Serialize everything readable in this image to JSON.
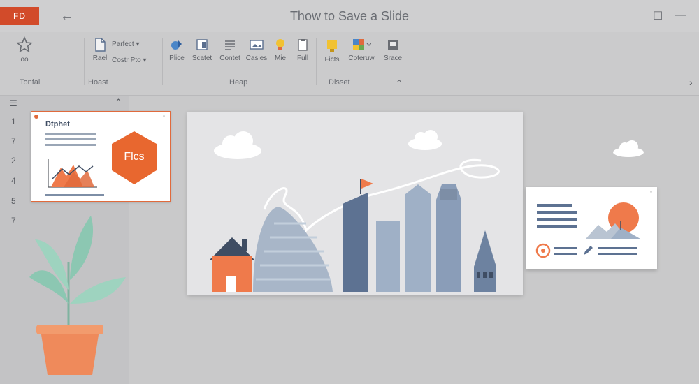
{
  "app": {
    "badge": "FD",
    "title": "Thow to Save a Slide"
  },
  "ribbon": {
    "favorite": {
      "label": "oo"
    },
    "home_items": [
      {
        "label": "Rael"
      },
      {
        "label": "Parfect ▾"
      },
      {
        "label": "Costr Pto ▾"
      }
    ],
    "heap_items": [
      {
        "label": "Plice"
      },
      {
        "label": "Scatet"
      },
      {
        "label": "Contet"
      },
      {
        "label": "Casies"
      },
      {
        "label": "Mie"
      },
      {
        "label": "Full"
      }
    ],
    "disset_items": [
      {
        "label": "Ficts"
      },
      {
        "label": "Coteruw"
      },
      {
        "label": "Srace"
      }
    ],
    "groups": {
      "tonfal": "Tonfal",
      "home": "Hoast",
      "heap": "Heap",
      "disset": "Disset"
    }
  },
  "sidebar": {
    "slide_numbers": [
      "1",
      "7",
      "2",
      "4",
      "5",
      "7"
    ]
  },
  "thumbnail": {
    "title": "Dtphet",
    "badge": "Flcs"
  },
  "colors": {
    "accent": "#d24b2a",
    "orange": "#ef7a4b",
    "slate": "#7d8ea6",
    "steel": "#9fb0c6"
  }
}
